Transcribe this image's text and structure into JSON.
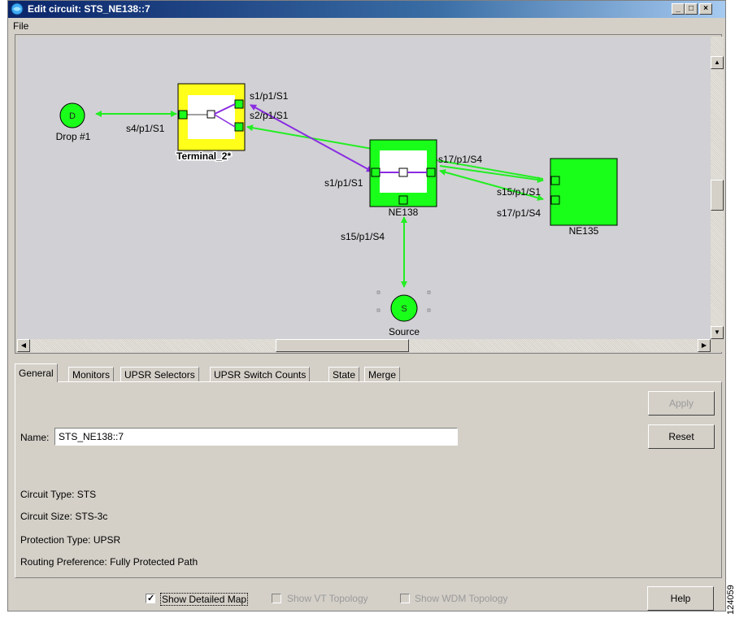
{
  "window": {
    "title": "Edit circuit: STS_NE138::7"
  },
  "menu": {
    "file": "File"
  },
  "map": {
    "nodes": {
      "drop": {
        "letter": "D",
        "label": "Drop #1"
      },
      "terminal": {
        "label": "Terminal_2*"
      },
      "ne138": {
        "label": "NE138"
      },
      "ne135": {
        "label": "NE135"
      },
      "source": {
        "letter": "S",
        "label": "Source"
      }
    },
    "port_labels": {
      "t_s1": "s1/p1/S1",
      "t_s2": "s2/p1/S1",
      "t_s4": "s4/p1/S1",
      "n138_s1": "s1/p1/S1",
      "n138_s17": "s17/p1/S4",
      "n138_s15": "s15/p1/S4",
      "n135_s15": "s15/p1/S1",
      "n135_s17": "s17/p1/S4"
    },
    "colors": {
      "background": "#d1d0d4",
      "node_green": "#1aff1a",
      "terminal_yellow": "#ffff1a",
      "path_green": "#22ee22",
      "path_purple": "#8a2be2"
    }
  },
  "tabs": [
    "General",
    "Monitors",
    "UPSR Selectors",
    "UPSR Switch Counts",
    "State",
    "Merge"
  ],
  "general": {
    "apply_label": "Apply",
    "reset_label": "Reset",
    "name_label": "Name:",
    "name_value": "STS_NE138::7",
    "circuit_type": "Circuit Type:  STS",
    "circuit_size": "Circuit Size: STS-3c",
    "protection_type": "Protection Type:  UPSR",
    "routing_preference": "Routing Preference: Fully Protected Path"
  },
  "bottom": {
    "show_detailed_map": "Show Detailed Map",
    "show_detailed_map_checked": true,
    "show_vt_topology": "Show VT Topology",
    "show_wdm_topology": "Show WDM Topology",
    "help_label": "Help"
  },
  "figure_number": "124059"
}
